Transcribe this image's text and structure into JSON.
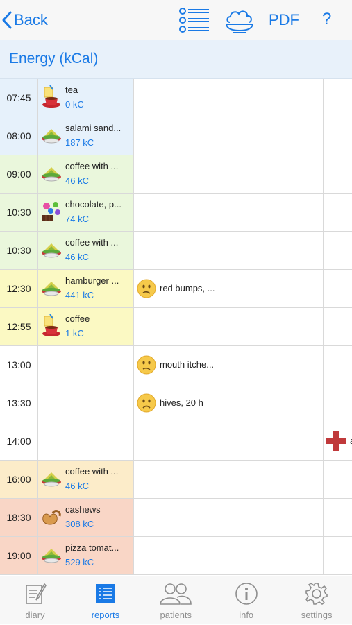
{
  "nav": {
    "back_label": "Back",
    "pdf_label": "PDF",
    "help_label": "?"
  },
  "header": {
    "title": "Energy (kCal)"
  },
  "colors": {
    "accent": "#1a7ae6",
    "blue_row": "#e6f1fb",
    "green_row": "#eaf7dc",
    "yellow_row": "#fbf9c3",
    "orange_row": "#fcecc9",
    "salmon_row": "#f9d6c6"
  },
  "rows": [
    {
      "time": "07:45",
      "food": "tea",
      "kc": "0 kC",
      "icon": "drink-icon",
      "color": "#e6f1fb",
      "symptom": "",
      "face": ""
    },
    {
      "time": "08:00",
      "food": "salami sand...",
      "kc": "187 kC",
      "icon": "dish-icon",
      "color": "#e6f1fb",
      "symptom": "",
      "face": ""
    },
    {
      "time": "09:00",
      "food": "coffee with ...",
      "kc": "46 kC",
      "icon": "dish-icon",
      "color": "#eaf7dc",
      "symptom": "",
      "face": ""
    },
    {
      "time": "10:30",
      "food": "chocolate, p...",
      "kc": "74 kC",
      "icon": "sweets-icon",
      "color": "#eaf7dc",
      "symptom": "",
      "face": ""
    },
    {
      "time": "10:30",
      "food": "coffee with ...",
      "kc": "46 kC",
      "icon": "dish-icon",
      "color": "#eaf7dc",
      "symptom": "",
      "face": ""
    },
    {
      "time": "12:30",
      "food": "hamburger ...",
      "kc": "441 kC",
      "icon": "dish-icon",
      "color": "#fbf9c3",
      "symptom": "red bumps, ...",
      "face": "confused-face-icon"
    },
    {
      "time": "12:55",
      "food": "coffee",
      "kc": "1 kC",
      "icon": "drink-icon",
      "color": "#fbf9c3",
      "symptom": "",
      "face": ""
    },
    {
      "time": "13:00",
      "food": "",
      "kc": "",
      "icon": "",
      "color": "#ffffff",
      "symptom": "mouth itche...",
      "face": "confused-face-icon"
    },
    {
      "time": "13:30",
      "food": "",
      "kc": "",
      "icon": "",
      "color": "#ffffff",
      "symptom": "hives, 20 h",
      "face": "worried-face-icon"
    },
    {
      "time": "14:00",
      "food": "",
      "kc": "",
      "icon": "",
      "color": "#ffffff",
      "symptom": "",
      "face": "",
      "medical": "a"
    },
    {
      "time": "16:00",
      "food": "coffee with ...",
      "kc": "46 kC",
      "icon": "dish-icon",
      "color": "#fcecc9",
      "symptom": "",
      "face": ""
    },
    {
      "time": "18:30",
      "food": "cashews",
      "kc": "308 kC",
      "icon": "nuts-icon",
      "color": "#f9d6c6",
      "symptom": "",
      "face": ""
    },
    {
      "time": "19:00",
      "food": "pizza tomat...",
      "kc": "529 kC",
      "icon": "dish-icon",
      "color": "#f9d6c6",
      "symptom": "",
      "face": ""
    }
  ],
  "tabs": [
    {
      "label": "diary",
      "icon": "diary-icon",
      "active": false
    },
    {
      "label": "reports",
      "icon": "reports-icon",
      "active": true
    },
    {
      "label": "patients",
      "icon": "patients-icon",
      "active": false
    },
    {
      "label": "info",
      "icon": "info-icon",
      "active": false
    },
    {
      "label": "settings",
      "icon": "settings-icon",
      "active": false
    }
  ]
}
